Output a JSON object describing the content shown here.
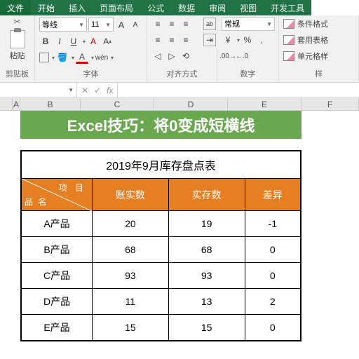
{
  "tabs": {
    "file": "文件",
    "home": "开始",
    "insert": "插入",
    "layout": "页面布局",
    "formulas": "公式",
    "data": "数据",
    "review": "审阅",
    "view": "视图",
    "dev": "开发工具"
  },
  "ribbon": {
    "clipboard": {
      "paste": "粘贴",
      "label": "剪贴板"
    },
    "font": {
      "name": "等线",
      "size": "11",
      "grow": "A",
      "shrink": "A",
      "label": "字体"
    },
    "align": {
      "wrap": "ab",
      "label": "对齐方式"
    },
    "number": {
      "format": "常规",
      "label": "数字"
    },
    "styles": {
      "cond": "条件格式",
      "table": "套用表格",
      "cell": "单元格样",
      "label": "样"
    }
  },
  "namebox": "",
  "cols": {
    "A": "A",
    "B": "B",
    "C": "C",
    "D": "D",
    "E": "E",
    "F": "F"
  },
  "banner": "Excel技巧：将0变成短横线",
  "table": {
    "title": "2019年9月库存盘点表",
    "corner_top": "项 目",
    "corner_bot": "品 名",
    "headers": [
      "账实数",
      "实存数",
      "差异"
    ],
    "rows": [
      {
        "name": "A产品",
        "book": "20",
        "actual": "19",
        "diff": "-1"
      },
      {
        "name": "B产品",
        "book": "68",
        "actual": "68",
        "diff": "0"
      },
      {
        "name": "C产品",
        "book": "93",
        "actual": "93",
        "diff": "0"
      },
      {
        "name": "D产品",
        "book": "11",
        "actual": "13",
        "diff": "2"
      },
      {
        "name": "E产品",
        "book": "15",
        "actual": "15",
        "diff": "0"
      }
    ]
  }
}
